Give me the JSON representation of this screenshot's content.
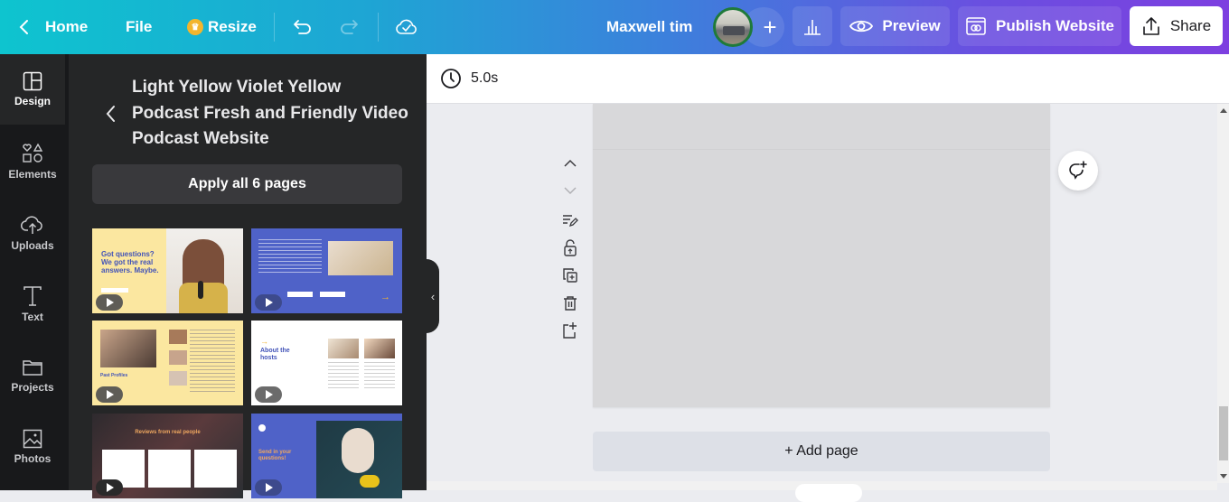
{
  "topbar": {
    "home_label": "Home",
    "file_label": "File",
    "resize_label": "Resize",
    "user_name": "Maxwell tim",
    "preview_label": "Preview",
    "publish_label": "Publish Website",
    "share_label": "Share",
    "icons": [
      "chevron-left-icon",
      "crown-icon",
      "undo-icon",
      "redo-icon",
      "cloud-check-icon",
      "plus-icon",
      "insights-icon",
      "eye-icon",
      "publish-icon",
      "upload-icon"
    ]
  },
  "rail": {
    "items": [
      {
        "label": "Design",
        "icon": "design-icon",
        "active": true
      },
      {
        "label": "Elements",
        "icon": "elements-icon"
      },
      {
        "label": "Uploads",
        "icon": "upload-cloud-icon"
      },
      {
        "label": "Text",
        "icon": "text-icon"
      },
      {
        "label": "Projects",
        "icon": "folder-icon"
      },
      {
        "label": "Photos",
        "icon": "image-icon"
      }
    ]
  },
  "panel": {
    "template_title": "Light Yellow Violet Yellow Podcast Fresh and Friendly Video Podcast Website",
    "apply_label": "Apply all 6 pages",
    "thumbnails": [
      {
        "headline": "Got questions? We got the real answers. Maybe.",
        "bg": "#fbe7a0",
        "video": true
      },
      {
        "headline": "",
        "bg": "#4f62c8",
        "video": true
      },
      {
        "headline": "Past Profiles",
        "bg": "#fbe7a0",
        "video": true
      },
      {
        "headline": "About the hosts",
        "bg": "#ffffff",
        "video": true
      },
      {
        "headline": "Reviews from real people",
        "bg": "#3b3233",
        "video": true
      },
      {
        "headline": "Send in your questions!",
        "bg": "#4f62c8",
        "video": true
      }
    ]
  },
  "editor": {
    "duration": "5.0s",
    "add_page_label": "+ Add page",
    "side_tools": [
      "chevron-up-icon",
      "chevron-down-icon",
      "notes-icon",
      "unlock-icon",
      "duplicate-icon",
      "trash-icon",
      "add-page-icon"
    ]
  },
  "colors": {
    "gradient_start": "#0ec4cf",
    "gradient_end": "#7d3fe0",
    "panel_bg": "#252627",
    "rail_bg": "#18191b",
    "canvas_bg": "#ebecf0",
    "page_placeholder": "#d8d8da"
  }
}
